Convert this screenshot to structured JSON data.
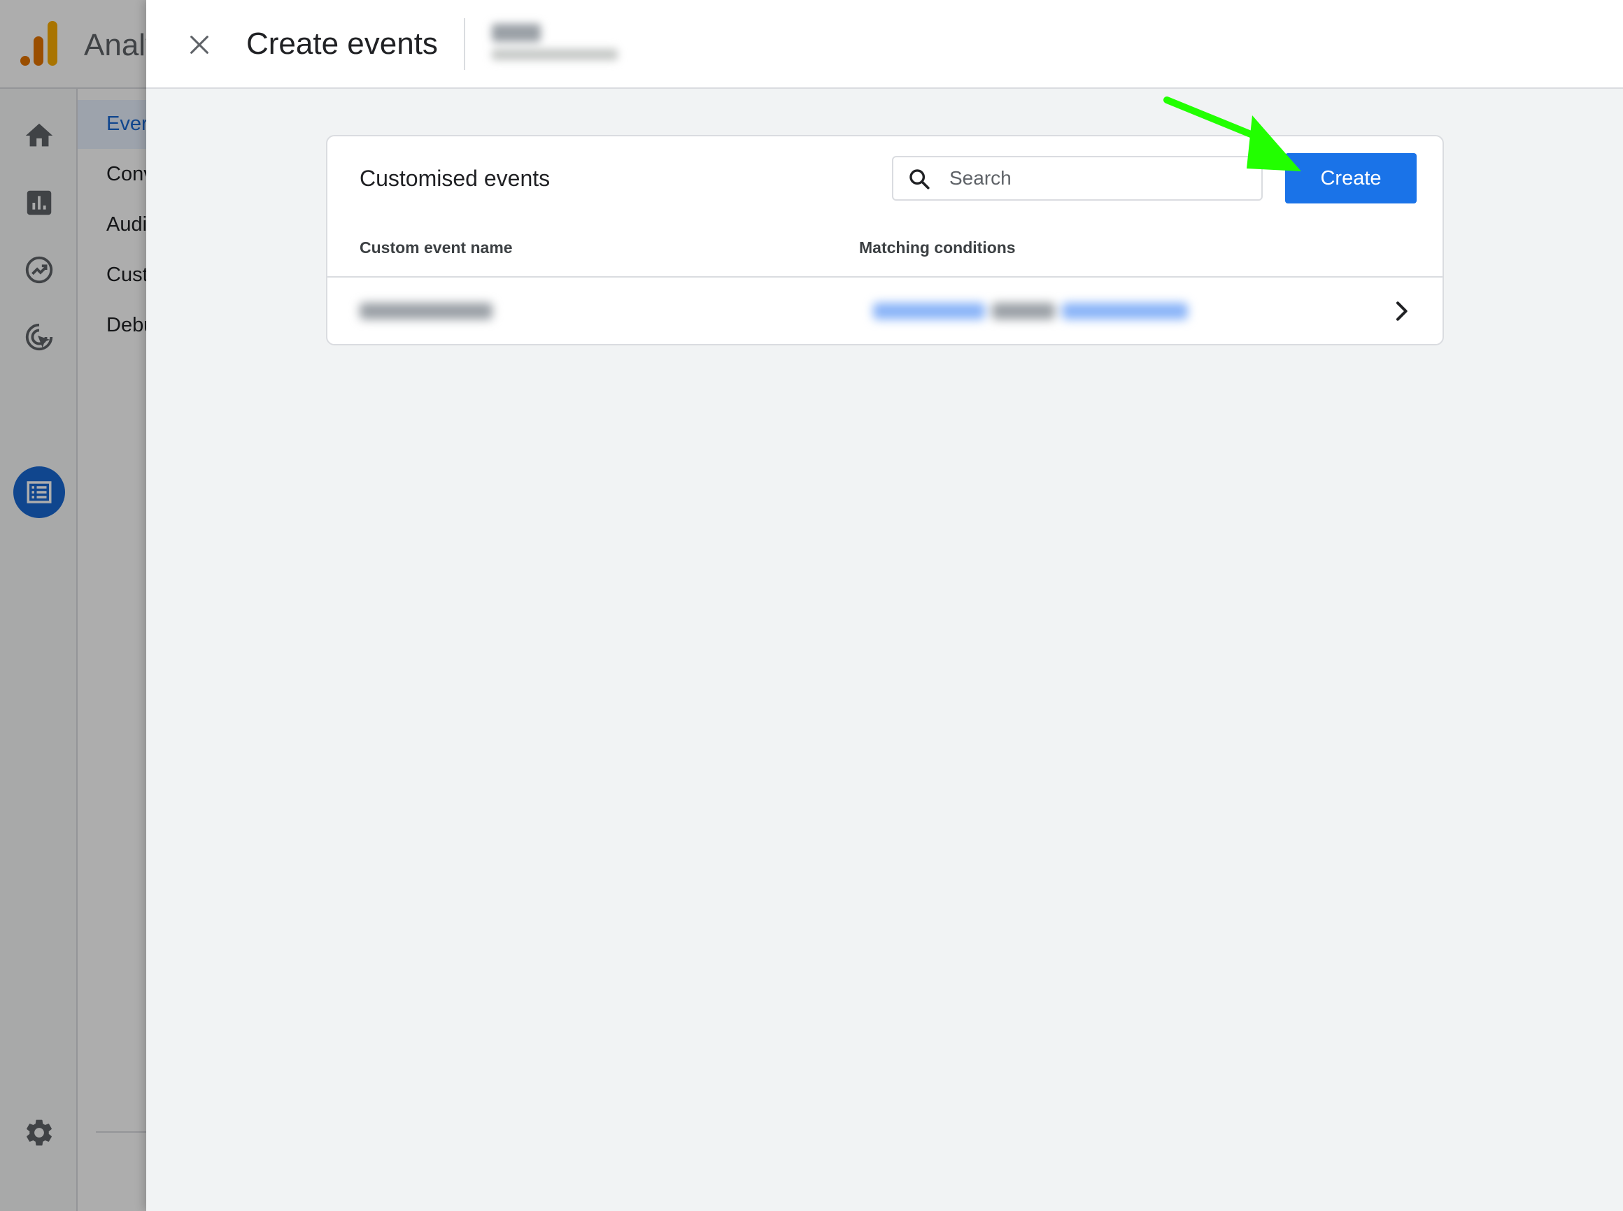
{
  "background_app": {
    "app_name": "Analy",
    "rail_icons": [
      "home-icon",
      "reports-icon",
      "explore-icon",
      "advertising-icon",
      "configure-icon",
      "settings-icon"
    ],
    "subnav_items": [
      "Ever",
      "Conv",
      "Audi",
      "Cust",
      "Debu"
    ],
    "accent_color": "#1967d2"
  },
  "drawer": {
    "title": "Create events",
    "close_icon": "close-icon"
  },
  "card": {
    "title": "Customised events",
    "search": {
      "placeholder": "Search",
      "value": ""
    },
    "create_button": "Create",
    "columns": {
      "name": "Custom event name",
      "conditions": "Matching conditions"
    },
    "rows": [
      {
        "chevron": "chevron-right-icon"
      }
    ]
  },
  "annotation": {
    "type": "arrow",
    "color": "#22ff00"
  },
  "colors": {
    "primary": "#1a73e8",
    "background": "#f1f3f4",
    "border": "#dadce0"
  }
}
